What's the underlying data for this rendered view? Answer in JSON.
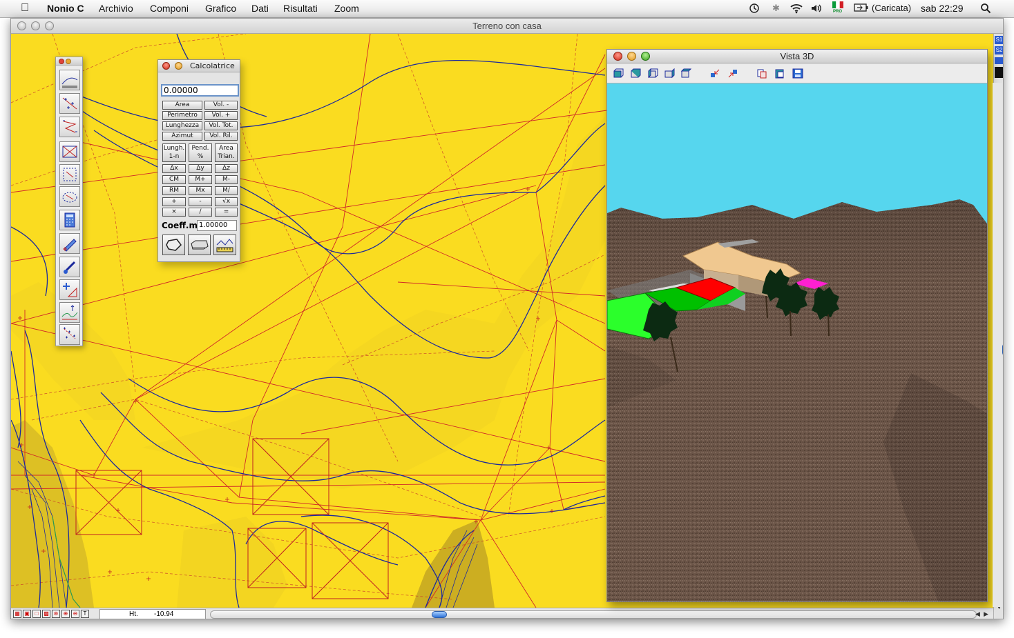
{
  "menubar": {
    "app_name": "Nonio C",
    "menus": [
      "Archivio",
      "Componi",
      "Grafico",
      "Dati",
      "Risultati",
      "Zoom"
    ],
    "battery_status": "(Caricata)",
    "clock": "sab 22:29",
    "flag_badge": "PRO"
  },
  "main_window": {
    "title": "Terreno con casa",
    "canvas_color": "#fadc20",
    "status": {
      "ht_label": "Ht.",
      "ht_value": "-10.94"
    },
    "strip_labels": [
      "S1",
      "S2"
    ]
  },
  "tool_palette": {
    "tools": [
      "contour-lines-tool",
      "points-tool",
      "polyline-tool",
      "triangulation-tool",
      "region-tool",
      "area-tool",
      "calculator-tool",
      "pencil-tool",
      "brush-tool",
      "move-tool",
      "profile-tool",
      "points-scatter-tool"
    ]
  },
  "calculator": {
    "title": "Calcolatrice",
    "display": "0.00000",
    "buttons_top": [
      [
        "Area",
        "Vol. -"
      ],
      [
        "Perimetro",
        "Vol. +"
      ],
      [
        "Lunghezza",
        "Vol. Tot."
      ],
      [
        "Azimut",
        "Vol. Ril."
      ]
    ],
    "buttons_tall": [
      [
        "Lungh.",
        "1-n"
      ],
      [
        "Pend.",
        "%"
      ],
      [
        "Area",
        "Trian."
      ]
    ],
    "buttons_grid": [
      [
        "Δx",
        "Δy",
        "Δz"
      ],
      [
        "CM",
        "M+",
        "M-"
      ],
      [
        "RM",
        "Mx",
        "M/"
      ],
      [
        "+",
        "-",
        "√x"
      ],
      [
        "×",
        "/",
        "="
      ]
    ],
    "coeff_label": "Coeff.m",
    "coeff_value": "1.00000"
  },
  "view3d": {
    "title": "Vista 3D",
    "sky_color": "#56d6ee",
    "terrain_color": "#6b5548",
    "toolbar": [
      "view-front-icon",
      "view-back-icon",
      "view-left-icon",
      "view-right-icon",
      "view-top-icon",
      "zoom-in-icon",
      "zoom-out-icon",
      "copy-icon",
      "paste-icon",
      "save-icon"
    ]
  }
}
